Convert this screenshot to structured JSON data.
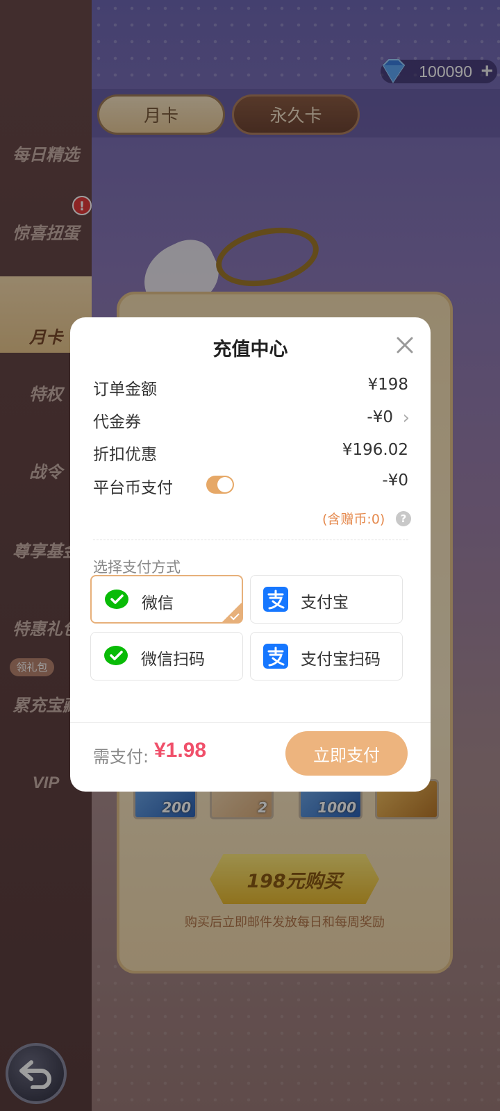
{
  "header": {
    "currency_amount": "100090",
    "gem_icon": "diamond-icon",
    "add_icon": "plus-icon"
  },
  "tabs": [
    {
      "label": "月卡"
    },
    {
      "label": "永久卡"
    }
  ],
  "sidebar": {
    "items": [
      {
        "label": "每日精选"
      },
      {
        "label": "惊喜扭蛋"
      },
      {
        "label": "月卡"
      },
      {
        "label": "特权"
      },
      {
        "label": "战令"
      },
      {
        "label": "尊享基金"
      },
      {
        "label": "特惠礼包"
      },
      {
        "label": "累充宝藏"
      },
      {
        "label": "VIP"
      }
    ],
    "alert_badge": "!",
    "gift_pack_badge": "领礼包"
  },
  "background_card": {
    "items": [
      "200",
      "2",
      "1000"
    ],
    "buy_button": "198元购买",
    "note": "购买后立即邮件发放每日和每周奖励"
  },
  "modal": {
    "title": "充值中心",
    "order_label": "订单金额",
    "order_value": "¥198",
    "voucher_label": "代金券",
    "voucher_value": "-¥0",
    "discount_label": "折扣优惠",
    "discount_value": "¥196.02",
    "platform_label": "平台币支付",
    "platform_value": "-¥0",
    "platform_toggle": true,
    "gift_note": "(含赠币:0)",
    "help": "?",
    "method_label": "选择支付方式",
    "methods": [
      {
        "label": "微信",
        "icon": "wechat-icon",
        "selected": true
      },
      {
        "label": "支付宝",
        "icon": "alipay-icon",
        "selected": false
      },
      {
        "label": "微信扫码",
        "icon": "wechat-icon",
        "selected": false
      },
      {
        "label": "支付宝扫码",
        "icon": "alipay-icon",
        "selected": false
      }
    ],
    "need_pay_label": "需支付:",
    "need_pay_amount": "¥1.98",
    "pay_button": "立即支付"
  },
  "colors": {
    "accent": "#edb47e",
    "price": "#f0506a",
    "wechat": "#09bb07",
    "alipay": "#1677ff"
  }
}
